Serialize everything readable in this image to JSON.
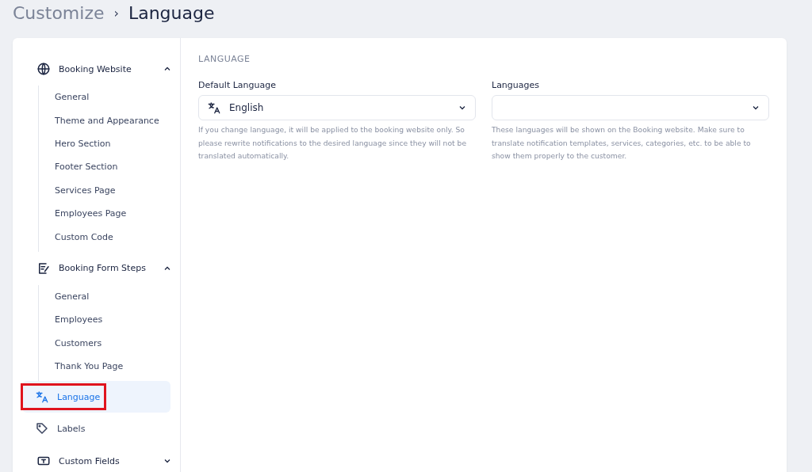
{
  "breadcrumb": {
    "parent": "Customize",
    "separator": "›",
    "current": "Language"
  },
  "sidebar": {
    "items": [
      {
        "kind": "group",
        "label": "Booking Website",
        "expanded": true,
        "children": [
          {
            "label": "General",
            "selected": false
          },
          {
            "label": "Theme and Appearance",
            "selected": false
          },
          {
            "label": "Hero Section",
            "selected": false
          },
          {
            "label": "Footer Section",
            "selected": false
          },
          {
            "label": "Services Page",
            "selected": false
          },
          {
            "label": "Employees Page",
            "selected": false
          },
          {
            "label": "Custom Code",
            "selected": false
          }
        ]
      },
      {
        "kind": "group",
        "label": "Booking Form Steps",
        "expanded": true,
        "children": [
          {
            "label": "General",
            "selected": false
          },
          {
            "label": "Employees",
            "selected": false
          },
          {
            "label": "Customers",
            "selected": false
          },
          {
            "label": "Thank You Page",
            "selected": false
          }
        ]
      },
      {
        "kind": "item",
        "label": "Language",
        "selected": true,
        "highlighted": true
      },
      {
        "kind": "item",
        "label": "Labels",
        "selected": false,
        "highlighted": false
      },
      {
        "kind": "group",
        "label": "Custom Fields",
        "expanded": false
      }
    ]
  },
  "section_title": "LANGUAGE",
  "fields": [
    {
      "label": "Default Language",
      "value": "English",
      "help": "If you change language, it will be applied to the booking website only. So please rewrite notifications to the desired language since they will not be translated automatically."
    },
    {
      "label": "Languages",
      "help": "These languages will be shown on the Booking website. Make sure to translate notification templates, services, categories, etc. to be able to show them properly to the customer."
    }
  ]
}
